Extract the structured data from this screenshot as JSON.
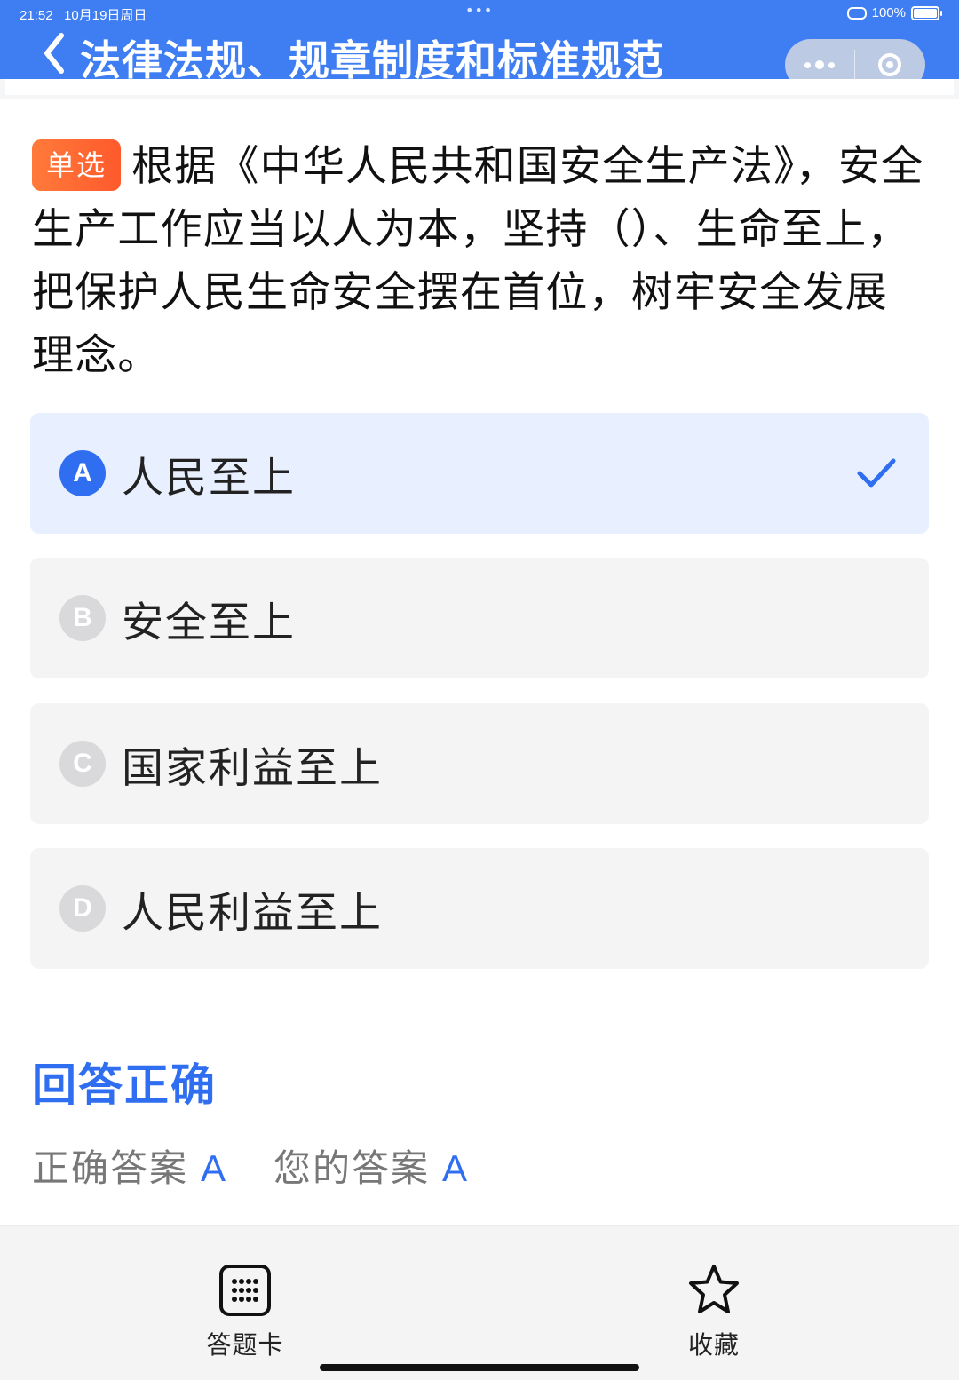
{
  "status_bar": {
    "time": "21:52",
    "date": "10月19日周日",
    "battery": "100%"
  },
  "header": {
    "title": "法律法规、规章制度和标准规范"
  },
  "question": {
    "type_tag": "单选",
    "text": "根据《中华人民共和国安全生产法》，安全生产工作应当以人为本，坚持（）、生命至上，把保护人民生命安全摆在首位，树牢安全发展理念。"
  },
  "options": [
    {
      "letter": "A",
      "text": "人民至上",
      "selected": true
    },
    {
      "letter": "B",
      "text": "安全至上",
      "selected": false
    },
    {
      "letter": "C",
      "text": "国家利益至上",
      "selected": false
    },
    {
      "letter": "D",
      "text": "人民利益至上",
      "selected": false
    }
  ],
  "result": {
    "title": "回答正确",
    "correct_label": "正确答案",
    "correct_value": "A",
    "your_label": "您的答案",
    "your_value": "A"
  },
  "bottom_bar": {
    "answer_card_label": "答题卡",
    "favorite_label": "收藏"
  },
  "colors": {
    "primary": "#3f7ef2",
    "accent": "#2f6ef0",
    "tag": "#ff6a33",
    "selected_bg": "#e8efff"
  }
}
